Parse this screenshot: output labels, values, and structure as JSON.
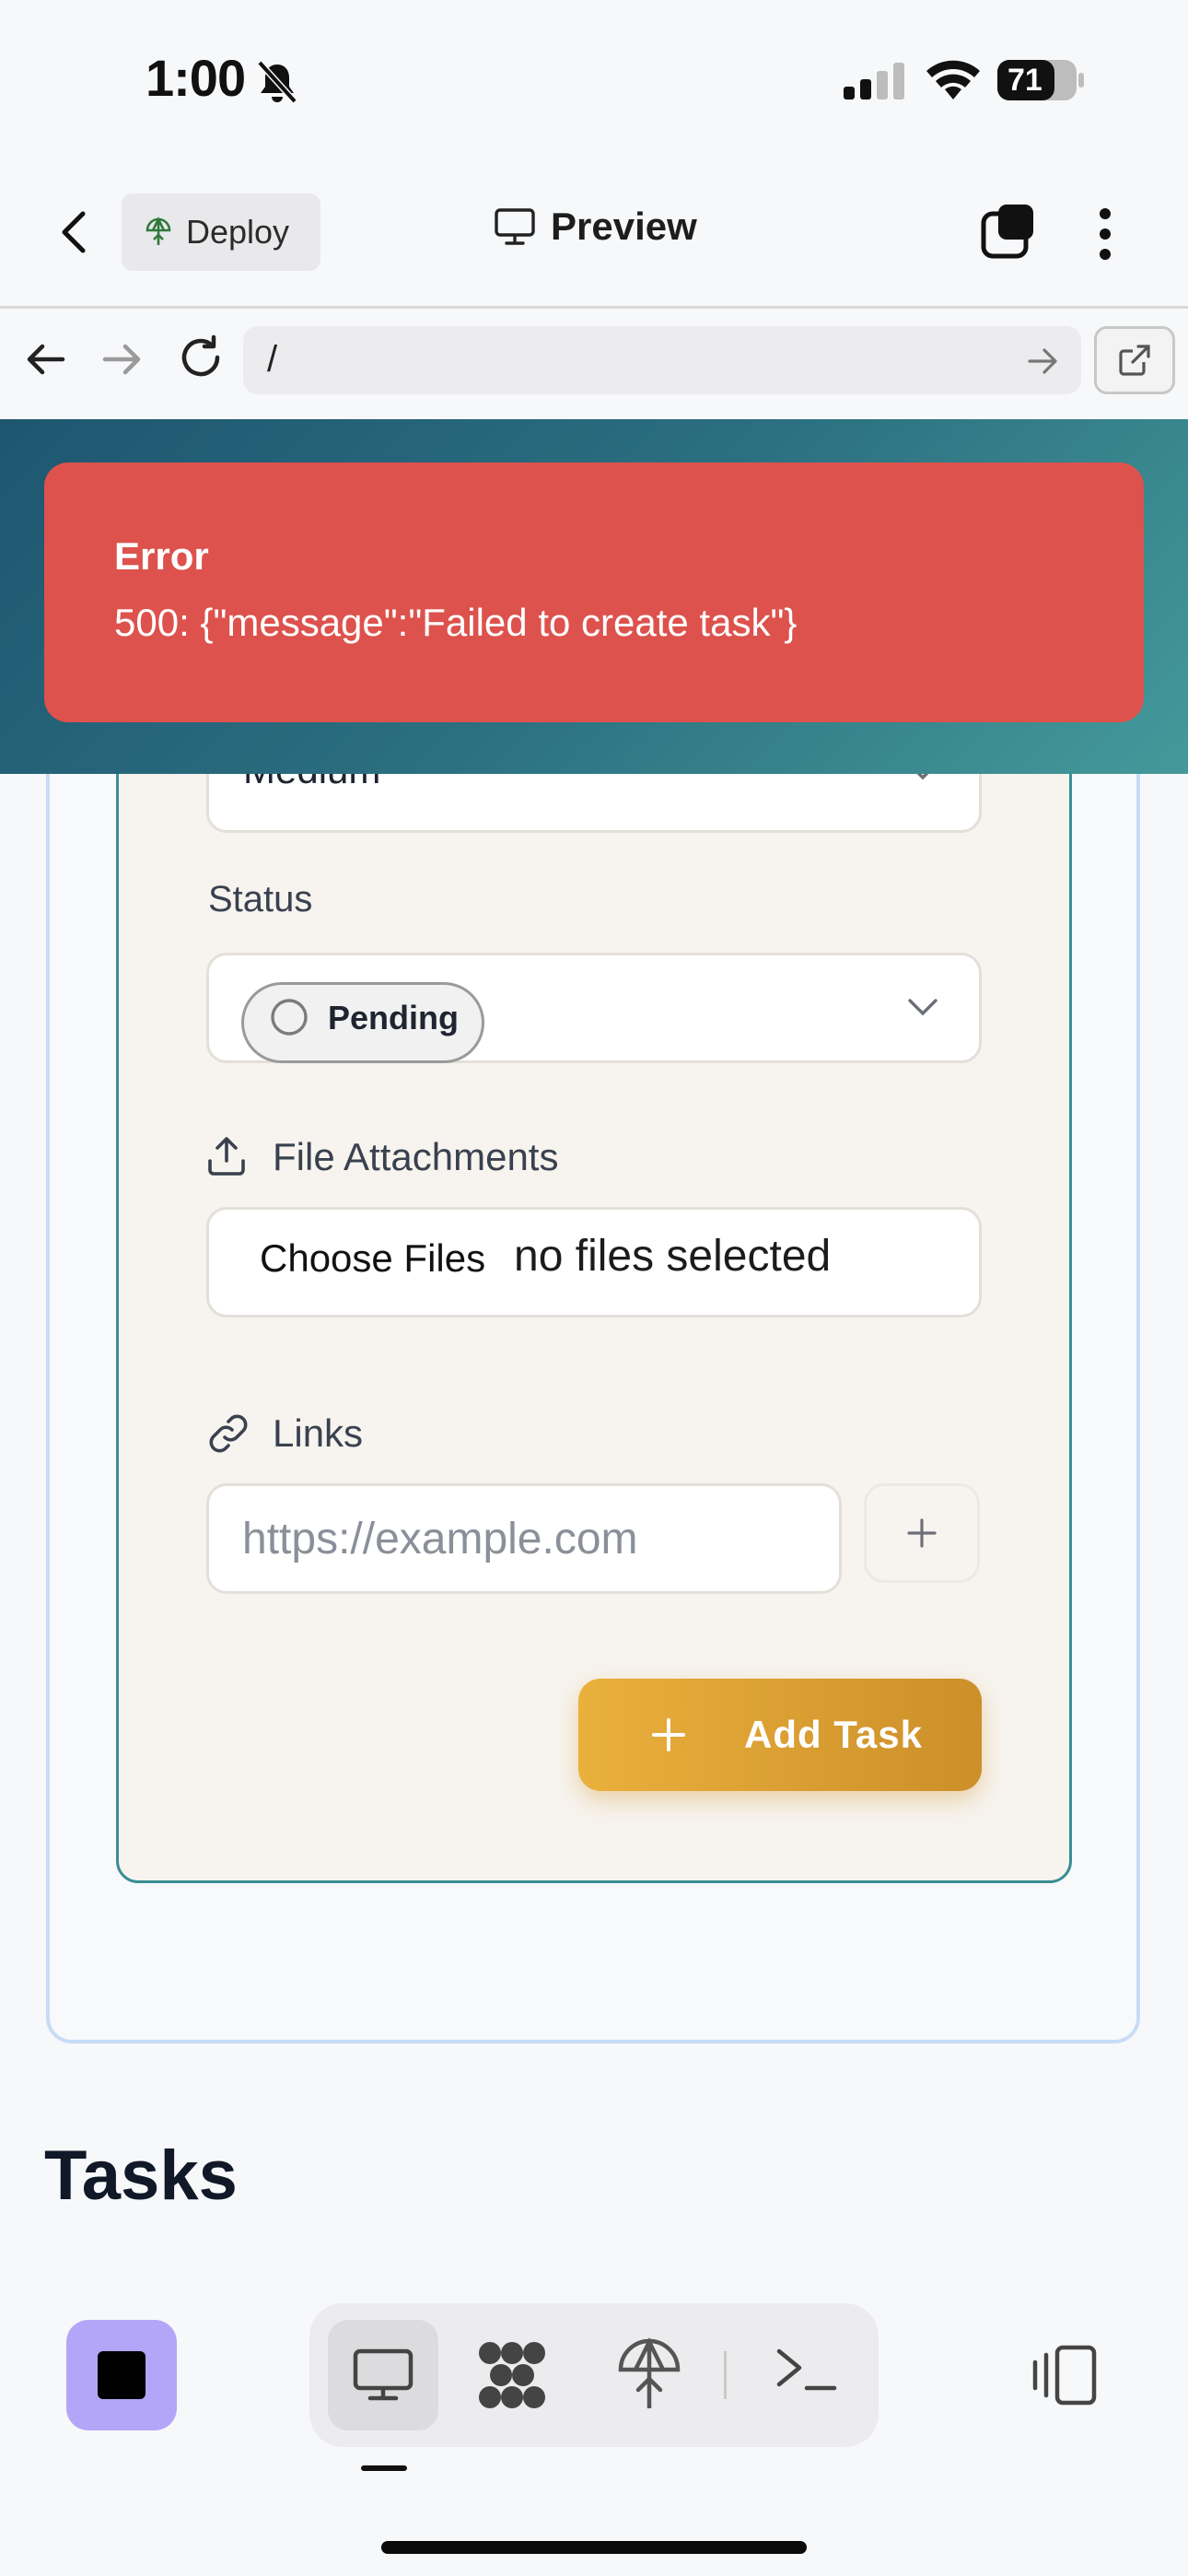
{
  "status_bar": {
    "time": "1:00",
    "battery": "71"
  },
  "header": {
    "deploy_label": "Deploy",
    "title": "Preview"
  },
  "url_bar": {
    "path": "/"
  },
  "form": {
    "priority_value": "Medium",
    "status_label": "Status",
    "status_value": "Pending",
    "attachments_label": "File Attachments",
    "choose_files_label": "Choose Files",
    "no_files_text": "no files selected",
    "links_label": "Links",
    "link_placeholder": "https://example.com",
    "add_task_label": "Add Task"
  },
  "tasks_heading": "Tasks",
  "toast": {
    "title": "Error",
    "message": "500: {\"message\":\"Failed to create task\"}"
  },
  "colors": {
    "toast_bg": "#dd524d",
    "accent_gold": "#e0a435",
    "form_border": "#3a8e95",
    "stop_button": "#b3a6f8"
  },
  "icons": {
    "back": "chevron-left-icon",
    "deploy": "deploy-icon",
    "preview": "monitor-icon",
    "tabs": "tabs-icon",
    "more": "more-vertical-icon",
    "reload": "reload-icon",
    "open_external": "external-link-icon",
    "attachments": "upload-icon",
    "links": "link-icon",
    "add": "plus-icon",
    "terminal": "terminal-icon",
    "agents": "agents-icon",
    "layout": "layout-toggle-icon"
  }
}
